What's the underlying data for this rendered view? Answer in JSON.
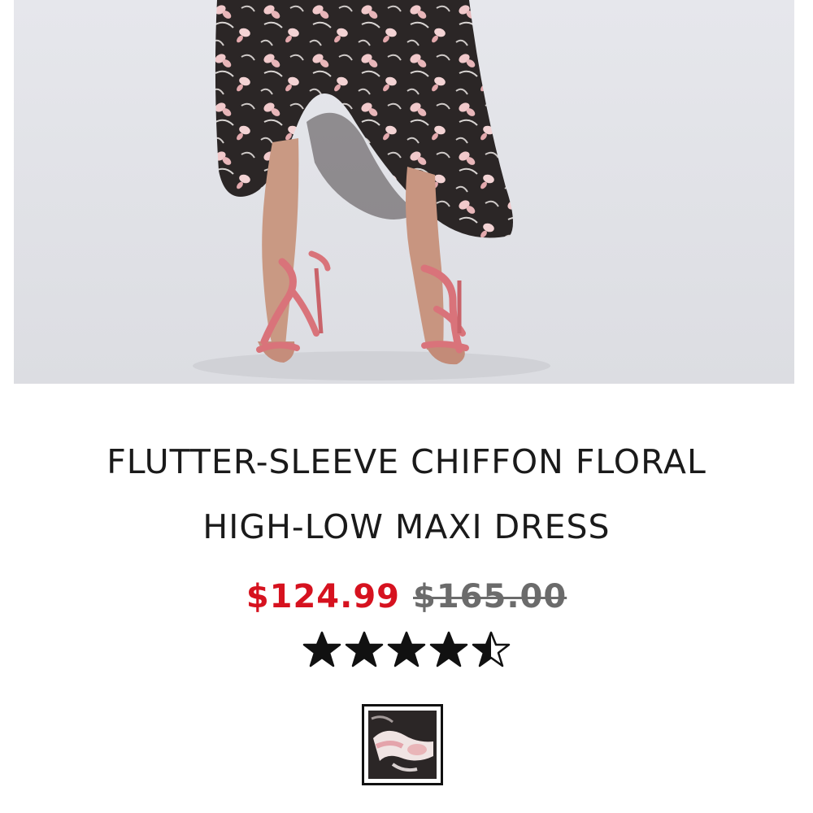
{
  "product": {
    "title_line1": "FLUTTER-SLEEVE CHIFFON FLORAL",
    "title_line2": "HIGH-LOW MAXI DRESS",
    "sale_price": "$124.99",
    "original_price": "$165.00",
    "rating": 4.5,
    "rating_max": 5,
    "swatch_color": "black floral"
  },
  "colors": {
    "sale": "#d6121f",
    "original": "#6b6b6b",
    "background_photo": "#e4e5ea",
    "dress": "#2b2626",
    "flower": "#f1c9cb",
    "sandal": "#d9737a"
  }
}
